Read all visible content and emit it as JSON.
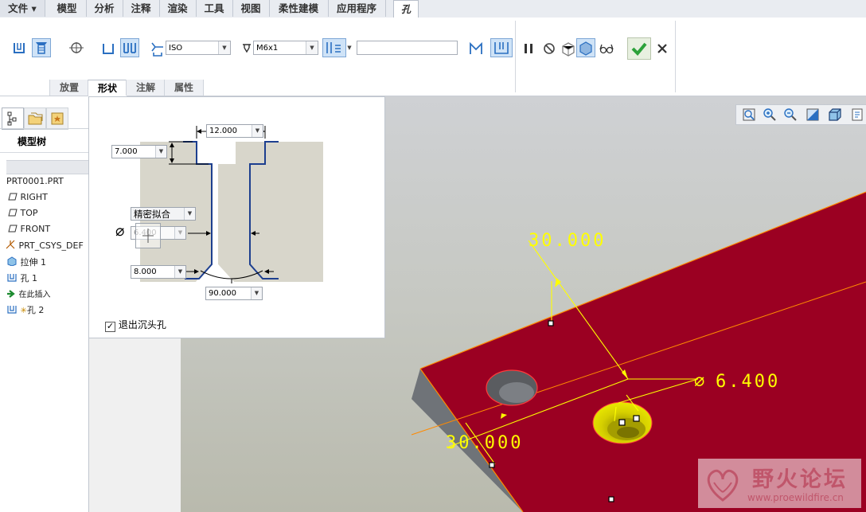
{
  "menu": {
    "file": "文件",
    "tabs": [
      "模型",
      "分析",
      "注释",
      "渲染",
      "工具",
      "视图",
      "柔性建模",
      "应用程序"
    ],
    "active_tab": "孔"
  },
  "ribbon": {
    "standard_combo": "ISO",
    "screw_size_combo": "M6x1",
    "depth_value": "",
    "subtabs": [
      "放置",
      "形状",
      "注解",
      "属性"
    ],
    "active_subtab": "形状"
  },
  "left_panel": {
    "title": "模型树",
    "items": [
      "PRT0001.PRT",
      "RIGHT",
      "TOP",
      "FRONT",
      "PRT_CSYS_DEF",
      "拉伸 1",
      "孔 1",
      "在此插入",
      "孔 2"
    ]
  },
  "shape_panel": {
    "top_dim": "12.000",
    "left_top_dim": "7.000",
    "fit_combo": "精密拟合",
    "diameter_dim": "6.400",
    "bottom_dim": "8.000",
    "angle_dim": "90.000",
    "exit_countersink_label": "退出沉头孔"
  },
  "viewport": {
    "dim_top": "30.000",
    "dim_diameter": "6.400",
    "dim_bottom": "30.000"
  },
  "watermark": {
    "cn": "野火论坛",
    "url": "www.proewildfire.cn"
  },
  "colors": {
    "part_face": "#9b0022",
    "dimension": "#ffff00",
    "edge_highlight": "#ff8a00",
    "active_blue": "#3a76c4"
  }
}
